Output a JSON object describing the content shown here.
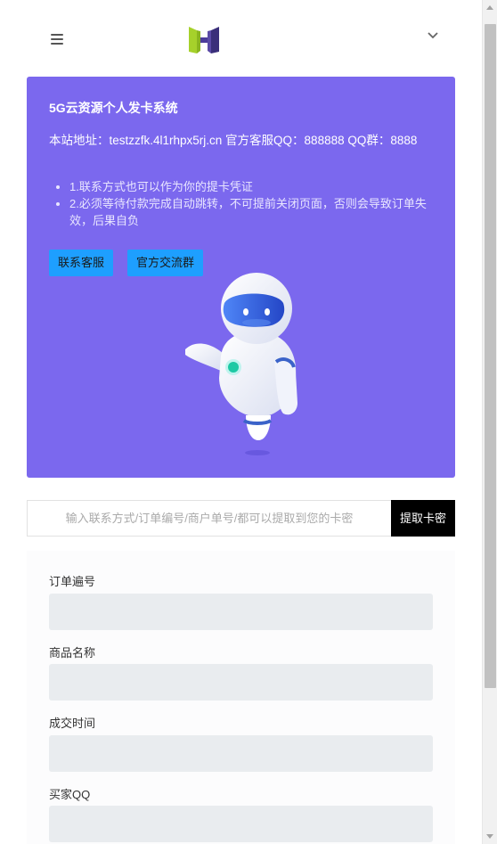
{
  "header": {
    "menu_icon": "hamburger-icon",
    "logo_icon": "h-logo-icon",
    "toggle_icon": "chevron-down-icon"
  },
  "hero": {
    "title": "5G云资源个人发卡系统",
    "site_info": "本站地址：testzzfk.4l1rhpx5rj.cn    官方客服QQ：888888    QQ群：8888",
    "notes": [
      "1.联系方式也可以作为你的提卡凭证",
      "2.必须等待付款完成自动跳转，不可提前关闭页面，否则会导致订单失效，后果自负"
    ],
    "buttons": {
      "service": "联系客服",
      "group": "官方交流群"
    },
    "background_color": "#7b68ee",
    "button_color": "#1e9fff"
  },
  "search": {
    "placeholder": "输入联系方式/订单编号/商户单号/都可以提取到您的卡密",
    "value": "",
    "button_label": "提取卡密"
  },
  "order": {
    "fields": [
      {
        "label": "订单遍号",
        "value": ""
      },
      {
        "label": "商品名称",
        "value": ""
      },
      {
        "label": "成交时间",
        "value": ""
      },
      {
        "label": "买家QQ",
        "value": ""
      }
    ]
  }
}
